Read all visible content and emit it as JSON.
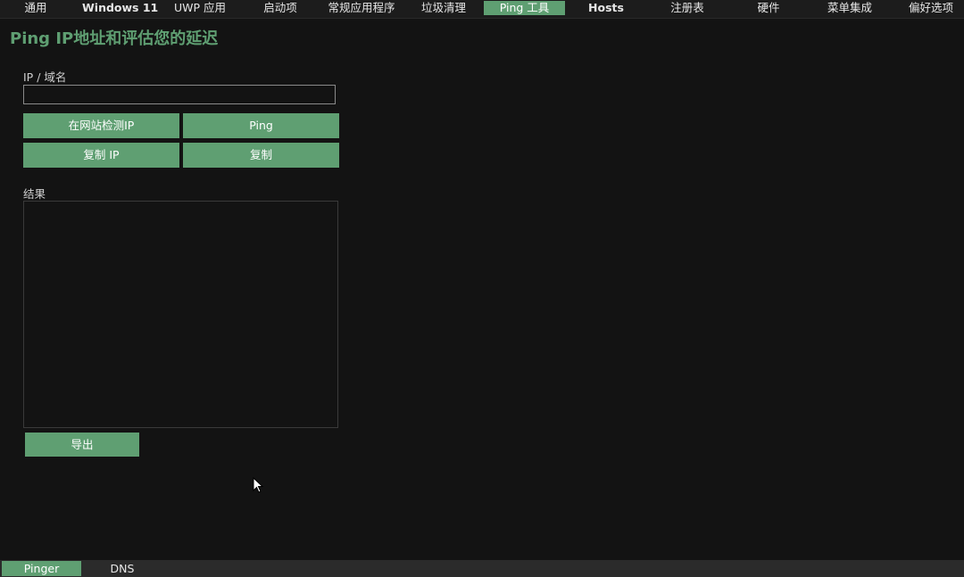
{
  "top_tabs": [
    {
      "label": "通用"
    },
    {
      "label": "Windows 11"
    },
    {
      "label": "UWP 应用"
    },
    {
      "label": "启动项"
    },
    {
      "label": "常规应用程序"
    },
    {
      "label": "垃圾清理"
    },
    {
      "label": "Ping 工具",
      "active": true
    },
    {
      "label": "Hosts"
    },
    {
      "label": "注册表"
    },
    {
      "label": "硬件"
    },
    {
      "label": "菜单集成"
    },
    {
      "label": "偏好选项"
    }
  ],
  "page": {
    "title": "Ping IP地址和评估您的延迟"
  },
  "form": {
    "ip_label": "IP / 域名",
    "ip_value": "",
    "ip_placeholder": "",
    "buttons": {
      "detect_ip": "在网站检测IP",
      "ping": "Ping",
      "copy_ip": "复制 IP",
      "copy": "复制"
    }
  },
  "result": {
    "label": "结果",
    "value": "",
    "export_label": "导出"
  },
  "bottom_tabs": [
    {
      "label": "Pinger",
      "active": true
    },
    {
      "label": "DNS"
    }
  ],
  "colors": {
    "accent": "#5f9f72",
    "background": "#131313",
    "topbar": "#1c1c1c",
    "bottombar": "#2b2b2b",
    "text": "#e6e6e6"
  },
  "icons": {
    "cursor": "mouse-pointer-icon"
  }
}
